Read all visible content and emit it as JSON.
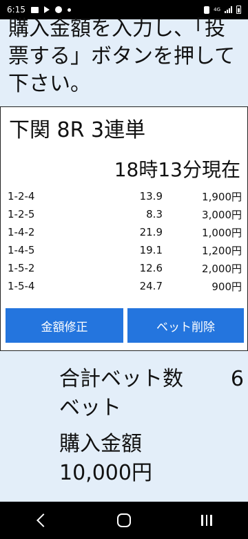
{
  "status_bar": {
    "time": "6:15",
    "network": "4G"
  },
  "instruction": "購入金額を入力し、「投票する」ボタンを押して下さい。",
  "bet_card": {
    "race_title": "下関 8R 3連単",
    "time_label": "18時13分現在",
    "bets": [
      {
        "combo": "1-2-4",
        "odds": "13.9",
        "amount": "1,900円"
      },
      {
        "combo": "1-2-5",
        "odds": "8.3",
        "amount": "3,000円"
      },
      {
        "combo": "1-4-2",
        "odds": "21.9",
        "amount": "1,000円"
      },
      {
        "combo": "1-4-5",
        "odds": "19.1",
        "amount": "1,200円"
      },
      {
        "combo": "1-5-2",
        "odds": "12.6",
        "amount": "2,000円"
      },
      {
        "combo": "1-5-4",
        "odds": "24.7",
        "amount": "900円"
      }
    ],
    "edit_amount_label": "金額修正",
    "delete_bet_label": "ベット削除"
  },
  "summary": {
    "total_bets_label": "合計ベット数",
    "total_bets_value": "6",
    "total_bets_unit": "ベット",
    "purchase_amount_label": "購入金額",
    "purchase_amount_value": "10,000円"
  },
  "colors": {
    "page_background": "#e3eef9",
    "button_blue": "#2475de"
  },
  "icons": [
    "image-icon",
    "play-icon",
    "record-icon",
    "dot-icon",
    "vibrate-icon",
    "signal-icon",
    "battery-icon",
    "back-icon",
    "home-icon",
    "recents-icon"
  ]
}
